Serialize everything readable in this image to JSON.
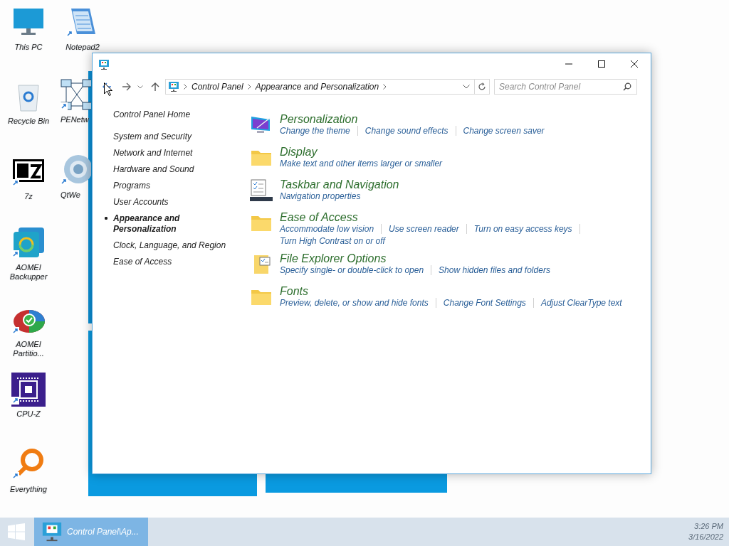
{
  "desktop": {
    "icons": [
      {
        "label": "This PC",
        "kind": "monitor"
      },
      {
        "label": "Recycle Bin",
        "kind": "bin"
      },
      {
        "label": "7z",
        "kind": "sevenzip"
      },
      {
        "label": "AOMEI Backupper",
        "kind": "backup"
      },
      {
        "label": "AOMEI Partitio...",
        "kind": "partition"
      },
      {
        "label": "CPU-Z",
        "kind": "chip"
      },
      {
        "label": "Everything",
        "kind": "magnifier"
      },
      {
        "label": "Notepad2",
        "kind": "notepad"
      },
      {
        "label": "PENetw",
        "kind": "network"
      },
      {
        "label": "QtWe",
        "kind": "globe"
      }
    ]
  },
  "window": {
    "address": {
      "segments": [
        "Control Panel",
        "Appearance and Personalization"
      ]
    },
    "search": {
      "placeholder": "Search Control Panel"
    },
    "sidebar": {
      "home": "Control Panel Home",
      "items": [
        {
          "label": "System and Security",
          "selected": false
        },
        {
          "label": "Network and Internet",
          "selected": false
        },
        {
          "label": "Hardware and Sound",
          "selected": false
        },
        {
          "label": "Programs",
          "selected": false
        },
        {
          "label": "User Accounts",
          "selected": false
        },
        {
          "label": "Appearance and Personalization",
          "selected": true
        },
        {
          "label": "Clock, Language, and Region",
          "selected": false
        },
        {
          "label": "Ease of Access",
          "selected": false
        }
      ]
    },
    "categories": [
      {
        "kind": "monitor",
        "title": "Personalization",
        "links": [
          "Change the theme",
          "Change sound effects",
          "Change screen saver"
        ]
      },
      {
        "kind": "folder",
        "title": "Display",
        "links": [
          "Make text and other items larger or smaller"
        ]
      },
      {
        "kind": "taskbar",
        "title": "Taskbar and Navigation",
        "links": [
          "Navigation properties"
        ]
      },
      {
        "kind": "folder",
        "title": "Ease of Access",
        "links": [
          "Accommodate low vision",
          "Use screen reader",
          "Turn on easy access keys",
          "Turn High Contrast on or off"
        ]
      },
      {
        "kind": "options",
        "title": "File Explorer Options",
        "links": [
          "Specify single- or double-click to open",
          "Show hidden files and folders"
        ]
      },
      {
        "kind": "folder",
        "title": "Fonts",
        "links": [
          "Preview, delete, or show and hide fonts",
          "Change Font Settings",
          "Adjust ClearType text"
        ]
      }
    ]
  },
  "taskbar": {
    "button": {
      "label": "Control Panel\\Ap...",
      "selected": true
    },
    "time": "3:26 PM",
    "date": "3/16/2022"
  }
}
